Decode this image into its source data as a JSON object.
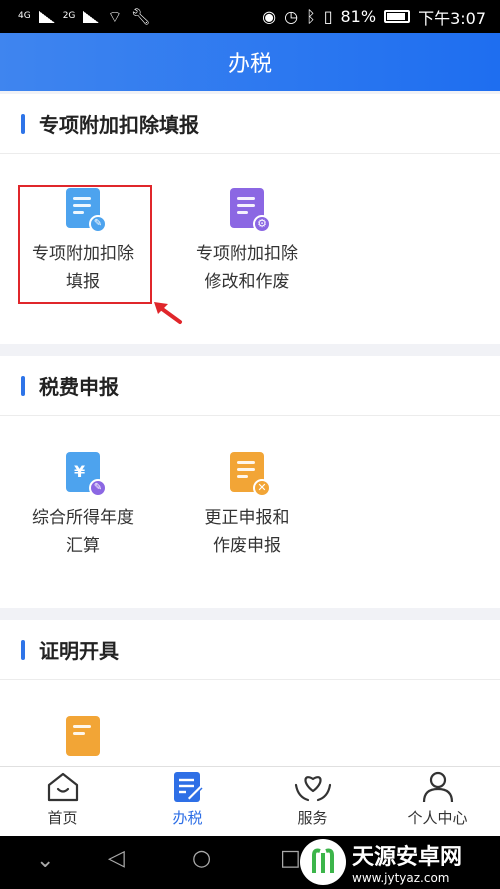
{
  "status_bar": {
    "network_1": "4G",
    "network_2": "2G",
    "battery_percent": "81%",
    "time": "下午3:07"
  },
  "header": {
    "title": "办税"
  },
  "sections": [
    {
      "title": "专项附加扣除填报",
      "items": [
        {
          "line1": "专项附加扣除",
          "line2": "填报",
          "icon": "edit-doc-icon",
          "color": "#4da3ee"
        },
        {
          "line1": "专项附加扣除",
          "line2": "修改和作废",
          "icon": "settings-doc-icon",
          "color": "#8b67e3"
        }
      ]
    },
    {
      "title": "税费申报",
      "items": [
        {
          "line1": "综合所得年度",
          "line2": "汇算",
          "icon": "yen-doc-icon",
          "symbol": "¥",
          "color": "#4da3ee"
        },
        {
          "line1": "更正申报和",
          "line2": "作废申报",
          "icon": "cancel-doc-icon",
          "color": "#f2a536"
        }
      ]
    },
    {
      "title": "证明开具",
      "items": [
        {
          "icon": "certificate-doc-icon",
          "color": "#f2a536"
        }
      ]
    }
  ],
  "tabbar": [
    {
      "label": "首页",
      "icon": "home-icon",
      "active": false
    },
    {
      "label": "办税",
      "icon": "tax-doc-icon",
      "active": true
    },
    {
      "label": "服务",
      "icon": "heart-hands-icon",
      "active": false
    },
    {
      "label": "个人中心",
      "icon": "person-icon",
      "active": false
    }
  ],
  "watermark": {
    "name": "天源安卓网",
    "url": "www.jytyaz.com"
  },
  "colors": {
    "primary": "#2e6fe6",
    "highlight": "#e0262b"
  }
}
